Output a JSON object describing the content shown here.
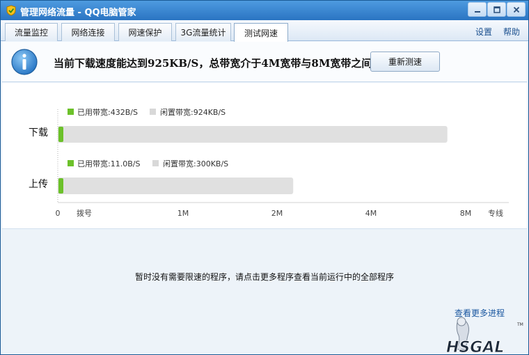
{
  "window": {
    "title": "管理网络流量 - QQ电脑管家"
  },
  "tabs": [
    {
      "label": "流量监控"
    },
    {
      "label": "网络连接"
    },
    {
      "label": "网速保护"
    },
    {
      "label": "3G流量统计"
    },
    {
      "label": "测试网速",
      "active": true
    }
  ],
  "tab_links": {
    "settings": "设置",
    "help": "帮助"
  },
  "banner": {
    "message": "当前下载速度能达到925KB/S，总带宽介于4M宽带与8M宽带之间",
    "retest_button": "重新测速"
  },
  "chart_data": {
    "type": "bar",
    "orientation": "horizontal",
    "categories": [
      "下载",
      "上传"
    ],
    "series": [
      {
        "name": "已用带宽",
        "labels": [
          "已用带宽:432B/S",
          "已用带宽:11.0B/S"
        ],
        "color": "#6cc12a"
      },
      {
        "name": "闲置带宽",
        "labels": [
          "闲置带宽:924KB/S",
          "闲置带宽:300KB/S"
        ],
        "color": "#e0e0e0"
      }
    ],
    "totals_kbps": [
      925,
      300
    ],
    "x_ticks": [
      {
        "label": "0",
        "kbps": 0
      },
      {
        "label": "拨号",
        "kbps": 7
      },
      {
        "label": "1M",
        "kbps": 128
      },
      {
        "label": "2M",
        "kbps": 256
      },
      {
        "label": "4M",
        "kbps": 512
      },
      {
        "label": "8M",
        "kbps": 1024
      },
      {
        "label": "专线",
        "kbps": 1200
      }
    ]
  },
  "lower": {
    "notice": "暂时没有需要限速的程序，请点击更多程序查看当前运行中的全部程序",
    "more_link": "查看更多进程",
    "watermark": "HSGAL"
  },
  "colors": {
    "accent": "#2a74c2",
    "used": "#6cc12a",
    "idle": "#e0e0e0"
  }
}
